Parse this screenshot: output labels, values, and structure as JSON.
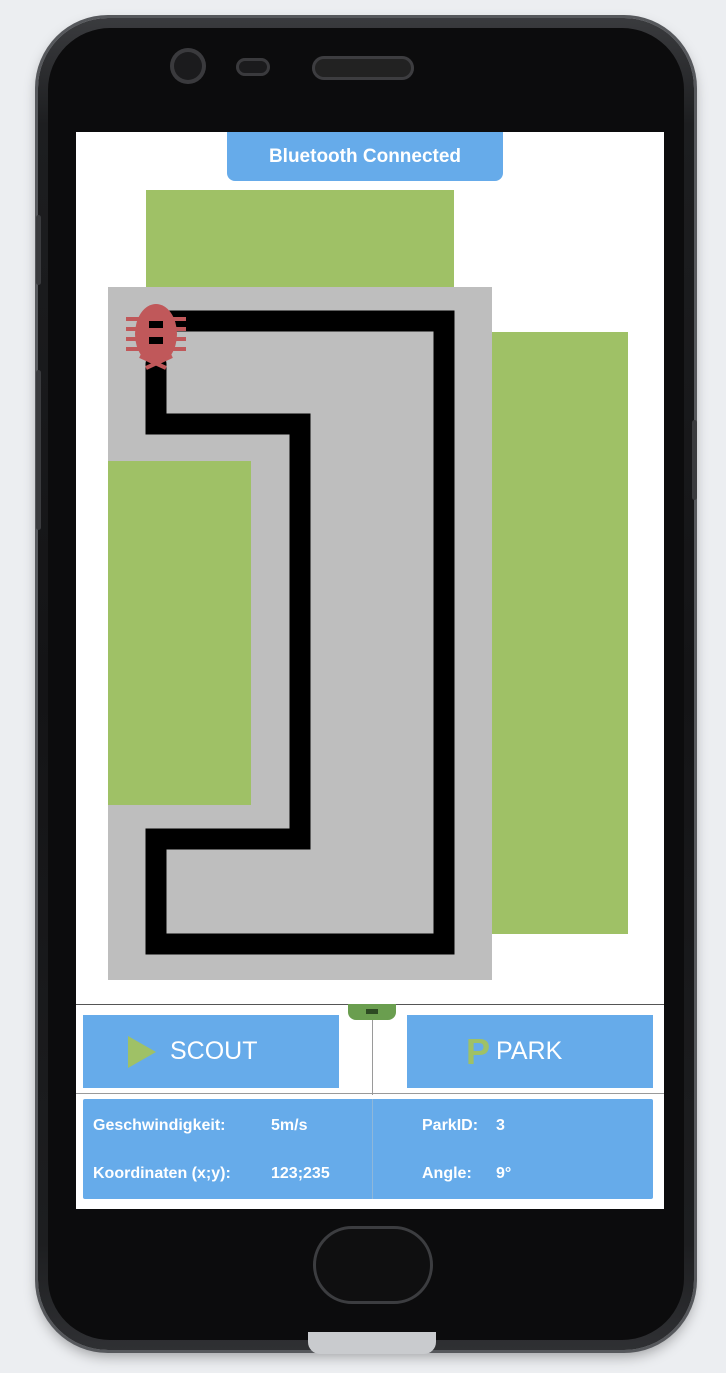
{
  "status": {
    "bluetooth_label": "Bluetooth Connected"
  },
  "controls": {
    "scout_label": "SCOUT",
    "park_label": "PARK",
    "park_icon_glyph": "P"
  },
  "info": {
    "speed_label": "Geschwindigkeit:",
    "speed_value": "5m/s",
    "coords_label": "Koordinaten (x;y):",
    "coords_value": "123;235",
    "park_id_label": "ParkID:",
    "park_id_value": "3",
    "angle_label": "Angle:",
    "angle_value": "9°"
  },
  "icons": {
    "robot": "robot-bug-icon",
    "scout": "play-triangle-icon",
    "park": "parking-p-icon"
  },
  "colors": {
    "accent_blue": "#66abea",
    "park_green": "#9fc166",
    "road_gray": "#bebebe",
    "route_black": "#000000",
    "robot_red": "#c0585a",
    "icon_green": "#9fc166"
  }
}
